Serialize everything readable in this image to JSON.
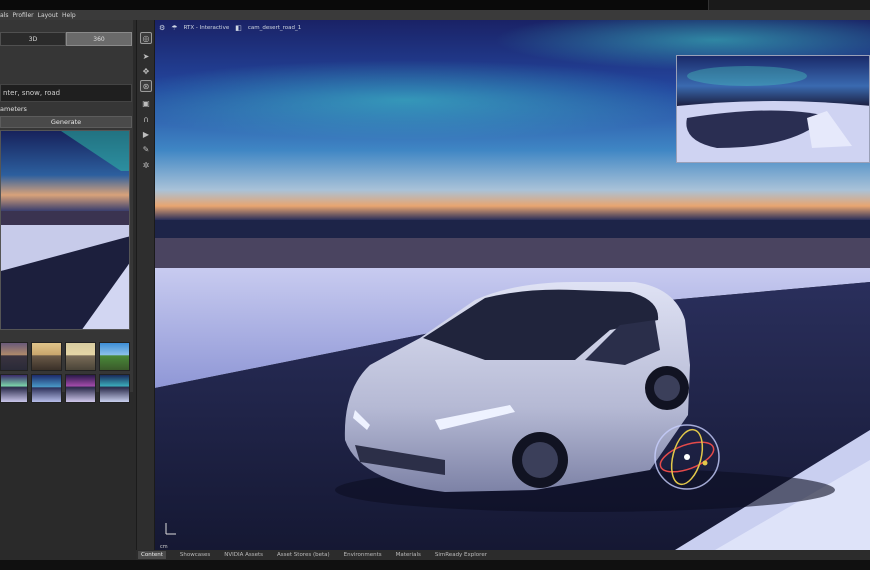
{
  "menu": {
    "items": [
      "als",
      "Profiler",
      "Layout",
      "Help"
    ]
  },
  "left_panel": {
    "tab_3d": "3D",
    "tab_360": "360",
    "prompt_value": "nter, snow, road",
    "parameters_label": "ameters",
    "generate_label": "Generate"
  },
  "viewport": {
    "render_mode": "RTX - Interactive",
    "camera": "cam_desert_road_1",
    "axis_unit": "cm"
  },
  "bottom_tabs": [
    "Content",
    "Showcases",
    "NVIDIA Assets",
    "Asset Stores (beta)",
    "Environments",
    "Materials",
    "SimReady Explorer"
  ],
  "colors": {
    "panel_bg": "#363636",
    "sky_top": "#1b2a6b",
    "aurora": "#2fa8c8",
    "snow": "#b9bde8",
    "road": "#1a1d3a"
  },
  "icons": [
    "select-icon",
    "move-icon",
    "rotate-icon",
    "scale-icon",
    "snap-icon",
    "magnet-icon",
    "play-icon",
    "paint-icon",
    "light-icon"
  ]
}
